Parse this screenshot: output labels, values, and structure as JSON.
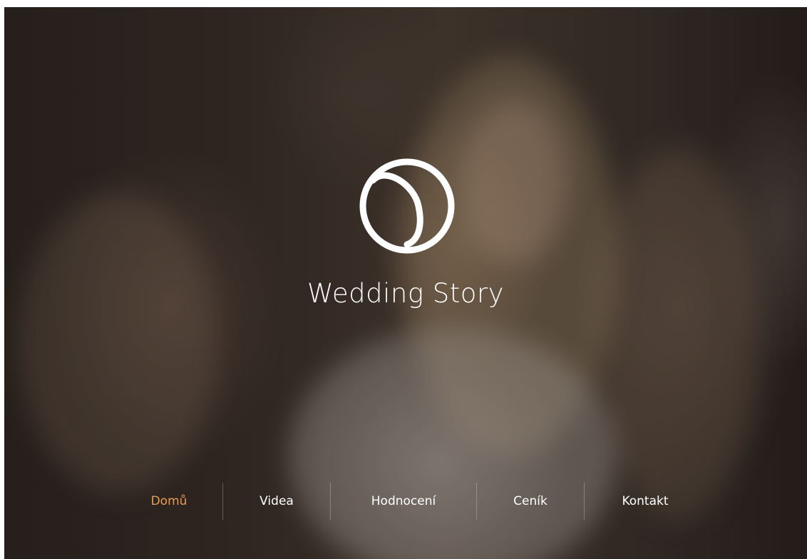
{
  "brand": {
    "name": "Wedding Story",
    "logo_icon": "s-circle-logo-icon"
  },
  "nav": {
    "items": [
      {
        "label": "Domů",
        "active": true
      },
      {
        "label": "Videa",
        "active": false
      },
      {
        "label": "Hodnocení",
        "active": false
      },
      {
        "label": "Ceník",
        "active": false
      },
      {
        "label": "Kontakt",
        "active": false
      }
    ]
  },
  "colors": {
    "accent": "#e99a55",
    "text": "#ffffff"
  }
}
